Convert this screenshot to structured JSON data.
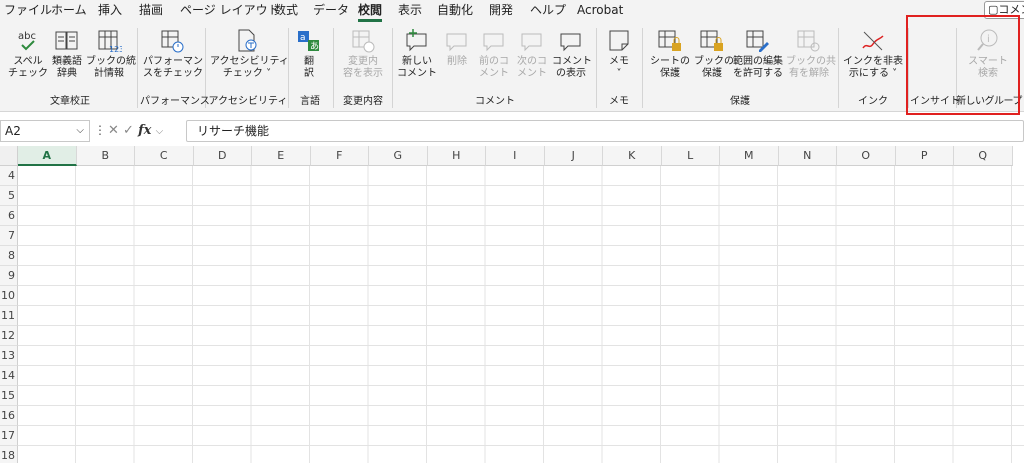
{
  "tabs": [
    "ファイル",
    "ホーム",
    "挿入",
    "描画",
    "ページ レイアウト",
    "数式",
    "データ",
    "校閲",
    "表示",
    "自動化",
    "開発",
    "ヘルプ",
    "Acrobat"
  ],
  "active_tab": "校閲",
  "comment_button": "コメント",
  "ribbon": {
    "buttons": [
      {
        "id": "spell",
        "icon": "abc-check-icon",
        "line1": "スペル",
        "line2": "チェック",
        "enabled": true
      },
      {
        "id": "thesaurus",
        "icon": "book-icon",
        "line1": "類義語",
        "line2": "辞典",
        "enabled": true
      },
      {
        "id": "stats",
        "icon": "workbook-stats-icon",
        "line1": "ブックの統",
        "line2": "計情報",
        "enabled": true
      },
      {
        "id": "perf",
        "icon": "performance-icon",
        "line1": "パフォーマン",
        "line2": "スをチェック",
        "enabled": true
      },
      {
        "id": "access",
        "icon": "accessibility-icon",
        "line1": "アクセシビリティ",
        "line2": "チェック ˅",
        "enabled": true
      },
      {
        "id": "translate",
        "icon": "translate-icon",
        "line1": "翻",
        "line2": "訳",
        "enabled": true
      },
      {
        "id": "changes",
        "icon": "show-changes-icon",
        "line1": "変更内",
        "line2": "容を表示",
        "enabled": false
      },
      {
        "id": "newcomment",
        "icon": "new-comment-icon",
        "line1": "新しい",
        "line2": "コメント",
        "enabled": true
      },
      {
        "id": "delete",
        "icon": "delete-comment-icon",
        "line1": "削除",
        "line2": "",
        "enabled": false
      },
      {
        "id": "prev",
        "icon": "previous-comment-icon",
        "line1": "前のコ",
        "line2": "メント",
        "enabled": false
      },
      {
        "id": "next",
        "icon": "next-comment-icon",
        "line1": "次のコ",
        "line2": "メント",
        "enabled": false
      },
      {
        "id": "showcomments",
        "icon": "show-comments-icon",
        "line1": "コメント",
        "line2": "の表示",
        "enabled": true
      },
      {
        "id": "memo",
        "icon": "note-icon",
        "line1": "メモ",
        "line2": "˅",
        "enabled": true
      },
      {
        "id": "protsheet",
        "icon": "protect-sheet-icon",
        "line1": "シートの",
        "line2": "保護",
        "enabled": true
      },
      {
        "id": "protbook",
        "icon": "protect-workbook-icon",
        "line1": "ブックの",
        "line2": "保護",
        "enabled": true
      },
      {
        "id": "allowedit",
        "icon": "allow-edit-ranges-icon",
        "line1": "範囲の編集",
        "line2": "を許可する",
        "enabled": true
      },
      {
        "id": "unshare",
        "icon": "unshare-workbook-icon",
        "line1": "ブックの共",
        "line2": "有を解除",
        "enabled": false
      },
      {
        "id": "hideink",
        "icon": "hide-ink-icon",
        "line1": "インクを非表",
        "line2": "示にする ˅",
        "enabled": true
      },
      {
        "id": "smartlookup",
        "icon": "smart-lookup-icon",
        "line1": "スマート",
        "line2": "検索",
        "enabled": false
      }
    ],
    "groups": [
      "文章校正",
      "パフォーマンス",
      "アクセシビリティ",
      "言語",
      "変更内容",
      "コメント",
      "メモ",
      "保護",
      "インク",
      "インサイト",
      "新しいグループ"
    ]
  },
  "formula_bar": {
    "name_box": "A2",
    "fx": "fx",
    "content": "リサーチ機能"
  },
  "sheet": {
    "columns": [
      "A",
      "B",
      "C",
      "D",
      "E",
      "F",
      "G",
      "H",
      "I",
      "J",
      "K",
      "L",
      "M",
      "N",
      "O",
      "P",
      "Q"
    ],
    "selected_column": "A",
    "rows": [
      "4",
      "5",
      "6",
      "7",
      "8",
      "9",
      "10",
      "11",
      "12",
      "13",
      "14",
      "15",
      "16",
      "17",
      "18"
    ]
  },
  "colors": {
    "accent": "#217346",
    "highlight": "#e0201f"
  }
}
